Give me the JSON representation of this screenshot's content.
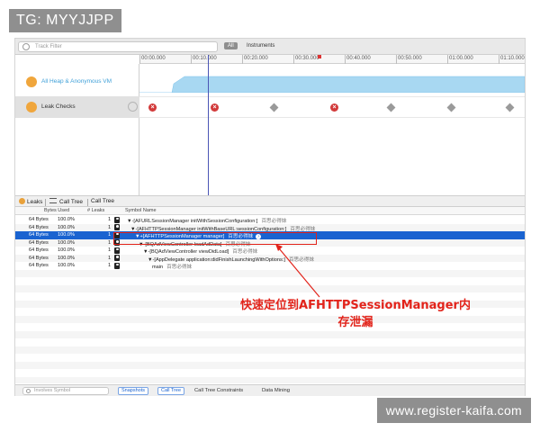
{
  "overlay": {
    "tag": "TG: MYYJJPP",
    "watermark": "www.register-kaifa.com"
  },
  "filterbar": {
    "search_placeholder": "Track Filter",
    "all_label": "All",
    "instruments_label": "Instruments"
  },
  "ruler": {
    "ticks": [
      "00:00.000",
      "00:10.000",
      "00:20.000",
      "00:30.000",
      "00:40.000",
      "00:50.000",
      "01:00.000",
      "01:10.000"
    ]
  },
  "tracks": {
    "heap_label": "All Heap & Anonymous VM",
    "leak_label": "Leak Checks"
  },
  "leak_markers": [
    "leak",
    "leak",
    "ok",
    "leak",
    "ok",
    "ok",
    "ok"
  ],
  "detailbar": {
    "leaks_label": "Leaks",
    "calltree_label": "Call Tree",
    "calltree2_label": "Call Tree"
  },
  "table": {
    "headers": {
      "bytes_used": "Bytes Used",
      "leaks": "# Leaks",
      "symbol": "Symbol Name"
    },
    "rows": [
      {
        "bytes": "64 Bytes",
        "pct": "100.0%",
        "leaks": "1",
        "symbol": "▼-[AFURLSessionManager initWithSessionConfiguration:]",
        "lib": "百思必得妹"
      },
      {
        "bytes": "64 Bytes",
        "pct": "100.0%",
        "leaks": "1",
        "symbol": "▼-[AFHTTPSessionManager initWithBaseURL:sessionConfiguration:]",
        "lib": "百思必得妹"
      },
      {
        "bytes": "64 Bytes",
        "pct": "100.0%",
        "leaks": "1",
        "symbol": "▼+[AFHTTPSessionManager manager]",
        "lib": "百思必得妹"
      },
      {
        "bytes": "64 Bytes",
        "pct": "100.0%",
        "leaks": "1",
        "symbol": "▼-[BQAdViewController loadAdData]",
        "lib": "百思必得妹"
      },
      {
        "bytes": "64 Bytes",
        "pct": "100.0%",
        "leaks": "1",
        "symbol": "▼-[BQAdViewController viewDidLoad]",
        "lib": "百思必得妹"
      },
      {
        "bytes": "64 Bytes",
        "pct": "100.0%",
        "leaks": "1",
        "symbol": "▼-[AppDelegate application:didFinishLaunchingWithOptions:]",
        "lib": "百思必得妹"
      },
      {
        "bytes": "64 Bytes",
        "pct": "100.0%",
        "leaks": "1",
        "symbol": "main",
        "lib": "百思必得妹"
      }
    ],
    "selected_index": 2
  },
  "annotation": {
    "line1": "快速定位到AFHTTPSessionManager内",
    "line2": "存泄漏"
  },
  "bottombar": {
    "search_placeholder": "Involves Symbol",
    "snapshots_label": "Snapshots",
    "calltree_label": "Call Tree",
    "constraints_label": "Call Tree Constraints",
    "datamining_label": "Data Mining"
  },
  "colors": {
    "selection": "#1a63d0",
    "annotation": "#e2231a",
    "heap_fill": "#a8d8f2",
    "leak_red": "#d23a3a"
  }
}
